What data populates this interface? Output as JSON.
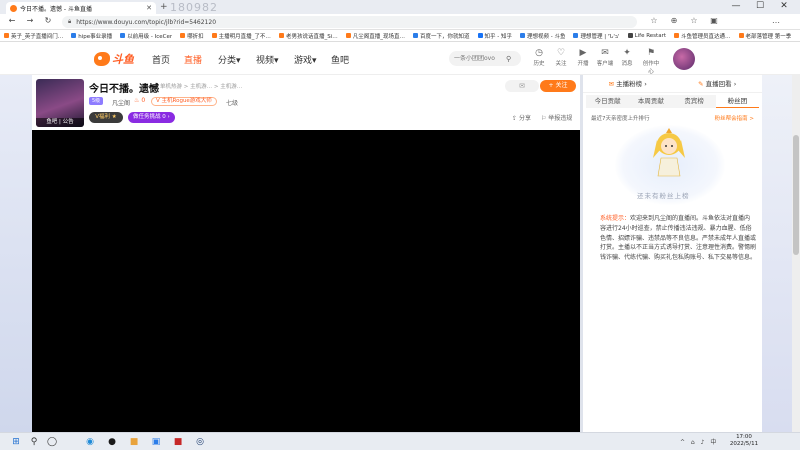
{
  "browser": {
    "tab_title": "今日不播。遗憾 - 斗鱼直播",
    "watermark": "180982",
    "url": "https://www.douyu.com/topic/jlb?rid=5462120",
    "controls": {
      "minimize": "—",
      "maximize": "☐",
      "close": "✕",
      "new_tab": "+",
      "tab_close": "✕"
    },
    "nav": {
      "back": "←",
      "forward": "→",
      "reload": "↻"
    },
    "toolbar_icons": [
      "☆",
      "⊕",
      "☆",
      "▣",
      "…"
    ],
    "bookmarks": [
      {
        "label": "英子_英子直播间门…",
        "color": "#ff7a1a"
      },
      {
        "label": "hipe事业录播",
        "color": "#2b7de9"
      },
      {
        "label": "以前用级 - IceCer",
        "color": "#2b7de9"
      },
      {
        "label": "哪折扣",
        "color": "#ff7a1a"
      },
      {
        "label": "主播明月直播_了不…",
        "color": "#ff7a1a"
      },
      {
        "label": "老男孩说话直播_Si…",
        "color": "#ff7a1a"
      },
      {
        "label": "凡尘阁直播_现场直…",
        "color": "#ff7a1a"
      },
      {
        "label": "百度一下，你就知道",
        "color": "#2b7de9"
      },
      {
        "label": "知乎 - 知乎",
        "color": "#1772f6"
      },
      {
        "label": "理想视频 - 斗鱼",
        "color": "#2b7de9"
      },
      {
        "label": "理想管理 | 'Ն'ב'",
        "color": "#2b7de9"
      },
      {
        "label": "Life Restart",
        "color": "#444444"
      },
      {
        "label": "斗鱼管理员直达通…",
        "color": "#ff7a1a"
      },
      {
        "label": "老部落管理 第一季",
        "color": "#ff7a1a"
      }
    ]
  },
  "site": {
    "logo_text": "斗鱼",
    "nav": [
      {
        "label": "首页",
        "active": false
      },
      {
        "label": "直播",
        "active": true
      },
      {
        "label": "分类▾",
        "active": false
      },
      {
        "label": "视频▾",
        "active": false
      },
      {
        "label": "游戏▾",
        "active": false
      },
      {
        "label": "鱼吧",
        "active": false
      }
    ],
    "search_placeholder": "一条小团团ovo",
    "search_icon": "⚲",
    "header_icons": [
      {
        "icon": "◷",
        "label": "历史"
      },
      {
        "icon": "♡",
        "label": "关注"
      },
      {
        "icon": "▶",
        "label": "开播"
      },
      {
        "icon": "✉",
        "label": "客户端"
      },
      {
        "icon": "✦",
        "label": "消息"
      },
      {
        "icon": "⚑",
        "label": "创作中心"
      }
    ]
  },
  "room": {
    "title": "今日不播。遗憾",
    "breadcrumb": "单机热游 > 主机游… > 主机游…",
    "avatar_label": "鱼吧 | 公告",
    "level": "5级",
    "anchor_name": "凡尘阁",
    "hot_icon": "♨",
    "hot": "0",
    "rank_badge": "V 主机Rogue游戏大师",
    "rank_label": "七级",
    "vip_badge": "V福利 ★",
    "challenge": "做任务挑战 0 ›",
    "share": "分享",
    "report": "举报违规",
    "msg": "✉",
    "follow": "+ 关注"
  },
  "panel": {
    "headers": [
      {
        "icon": "✉",
        "label": "主播粉榜 ›"
      },
      {
        "icon": "✎",
        "label": "直播回看 ›"
      }
    ],
    "tabs": [
      {
        "label": "今日贡献",
        "on": false
      },
      {
        "label": "本周贡献",
        "on": false
      },
      {
        "label": "贵宾榜",
        "on": false
      },
      {
        "label": "粉丝团",
        "on": true
      }
    ],
    "rank7": "最近7天亲密度上升排行",
    "more": "粉丝帮会指南 >",
    "empty": "还未有粉丝上榜",
    "notice_key": "系统提示：",
    "notice": "欢迎来到凡尘阁的直播间。斗鱼依法对直播内容进行24小时巡查，禁止传播违法违规、暴力血腥、低俗色情、招嫖诈骗、违禁品等不良信息。严禁未成年人直播或打赏。主播以不正当方式诱导打赏、注意理性消费。警惕刷钱诈骗、代练代骗、购买礼包私购账号、私下交易等信息。"
  },
  "taskbar": {
    "start": "⊞",
    "search": "⚲",
    "view": "◯",
    "apps": [
      {
        "icon": "◉",
        "color": "#1f8bd8"
      },
      {
        "icon": "●",
        "color": "#1a1a1a"
      },
      {
        "icon": "■",
        "color": "#e8a33d"
      },
      {
        "icon": "▣",
        "color": "#2b7de9"
      },
      {
        "icon": "■",
        "color": "#c62828"
      },
      {
        "icon": "◎",
        "color": "#1b3b6f"
      }
    ],
    "tray": "^ ⌂ ♪ 中",
    "time": "17:00",
    "date": "2022/5/11"
  }
}
